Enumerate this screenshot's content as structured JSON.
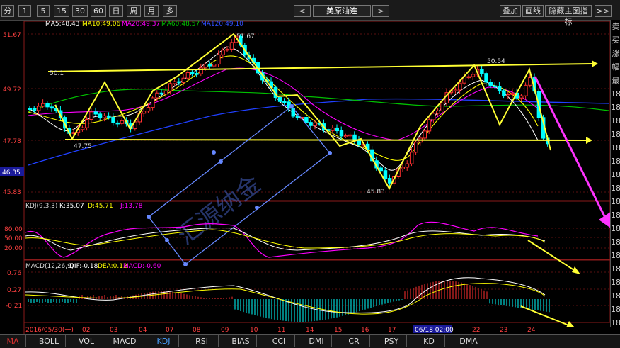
{
  "toolbar": {
    "buttons": [
      "分",
      "1",
      "5",
      "15",
      "30",
      "60",
      "日",
      "周",
      "月",
      "多"
    ],
    "nav_left": "<",
    "nav_right": ">",
    "symbol": "美原油连",
    "actions": [
      "叠加",
      "画线",
      "隐藏主图指标",
      ">>"
    ]
  },
  "main_legend": {
    "ma5": "MA5:48.43",
    "ma10": "MA10:49.06",
    "ma20": "MA20:49.37",
    "ma60": "MA60:48.57",
    "ma120": "MA120:49.10"
  },
  "price_axis": [
    "51.67",
    "49.72",
    "47.78",
    "45.83"
  ],
  "current_price": "46.35",
  "annotations": {
    "high": "51.67",
    "left_mark": "50.1",
    "right_high": "50.54",
    "low_left": "47.75",
    "low_mid": "45.83"
  },
  "watermark": "汇源纳金",
  "kdj_legend": {
    "title": "KDJ(9,3,3)",
    "k": "K:35.07",
    "d": "D:45.71",
    "j": "J:13.78"
  },
  "kdj_axis": [
    "80.00",
    "50.00",
    "20.00"
  ],
  "macd_legend": {
    "title": "MACD(12,26,9)",
    "dif": "DIF:-0.18",
    "dea": "DEA:0.12",
    "macd": "MACD:-0.60"
  },
  "macd_axis": [
    "0.76",
    "0.27",
    "-0.21"
  ],
  "date_axis": [
    "2016/05/30(一)",
    "02",
    "03",
    "04",
    "07",
    "08",
    "09",
    "10",
    "11",
    "14",
    "15",
    "16",
    "17",
    "06/18 02:00",
    "22",
    "23",
    "24"
  ],
  "right_panel": [
    "卖",
    "买",
    "涨",
    "幅",
    "最",
    "18",
    "18",
    "18",
    "18",
    "18",
    "18",
    "18",
    "18",
    "18",
    "18",
    "18",
    "18",
    "18",
    "18",
    "18",
    "18",
    "18",
    "18"
  ],
  "bottom_tabs": [
    "MA",
    "BOLL",
    "VOL",
    "MACD",
    "KDJ",
    "RSI",
    "BIAS",
    "CCI",
    "DMI",
    "CR",
    "PSY",
    "KD",
    "DMA"
  ],
  "colors": {
    "up": "#ff3030",
    "down": "#00ffff",
    "ma5": "#ffffff",
    "ma10": "#ffff00",
    "ma20": "#ff00ff",
    "ma60": "#00c000",
    "ma120": "#2040ff",
    "trend": "#ffff33",
    "arrow": "#ff33ff",
    "rect": "#6688ff"
  }
}
